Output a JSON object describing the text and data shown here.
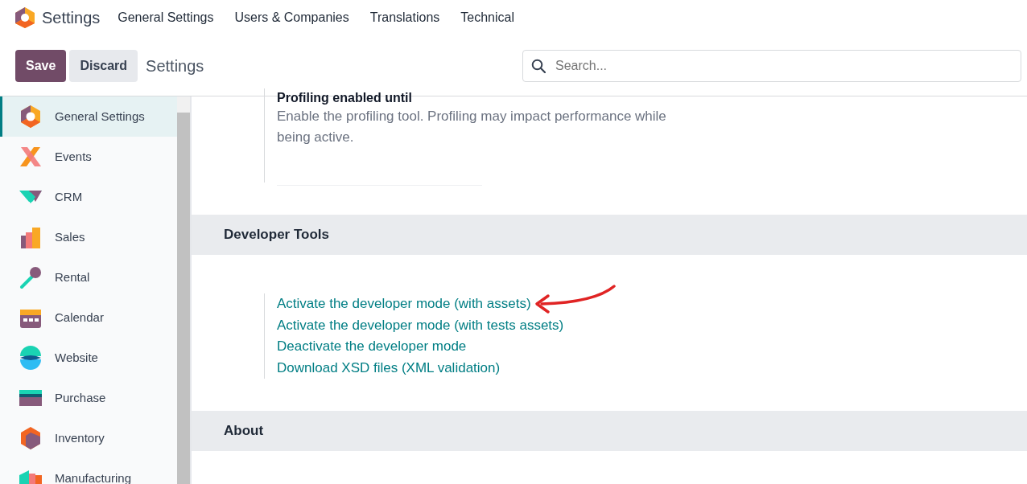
{
  "navbar": {
    "app_title": "Settings",
    "menu": [
      "General Settings",
      "Users & Companies",
      "Translations",
      "Technical"
    ]
  },
  "control_panel": {
    "save": "Save",
    "discard": "Discard",
    "breadcrumb": "Settings",
    "search": {
      "placeholder": "Search..."
    }
  },
  "sidebar": {
    "items": [
      {
        "label": "General Settings",
        "selected": true
      },
      {
        "label": "Events",
        "selected": false
      },
      {
        "label": "CRM",
        "selected": false
      },
      {
        "label": "Sales",
        "selected": false
      },
      {
        "label": "Rental",
        "selected": false
      },
      {
        "label": "Calendar",
        "selected": false
      },
      {
        "label": "Website",
        "selected": false
      },
      {
        "label": "Purchase",
        "selected": false
      },
      {
        "label": "Inventory",
        "selected": false
      },
      {
        "label": "Manufacturing",
        "selected": false
      }
    ]
  },
  "profiling": {
    "title": "Profiling enabled until",
    "description": "Enable the profiling tool. Profiling may impact performance while being active."
  },
  "sections": [
    {
      "title": "Developer Tools",
      "links": [
        "Activate the developer mode (with assets)",
        "Activate the developer mode (with tests assets)",
        "Deactivate the developer mode",
        "Download XSD files (XML validation)"
      ]
    },
    {
      "title": "About"
    }
  ]
}
